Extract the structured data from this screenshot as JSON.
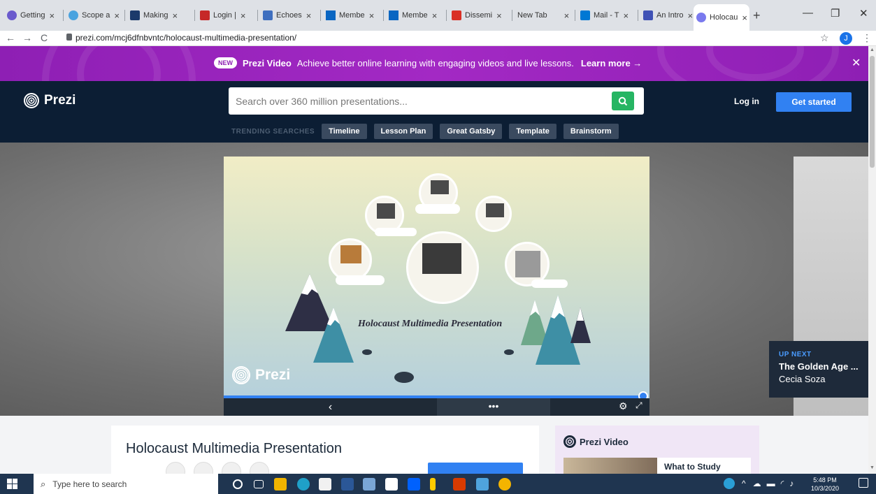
{
  "tabs": [
    {
      "label": "Getting",
      "color": "#6a5acd"
    },
    {
      "label": "Scope a",
      "color": "#4aa3df"
    },
    {
      "label": "Making",
      "color": "#1b3a6b"
    },
    {
      "label": "Login |",
      "color": "#c62828"
    },
    {
      "label": "Echoes",
      "color": "#3f6fbf"
    },
    {
      "label": "Membe",
      "color": "#0a66c2"
    },
    {
      "label": "Membe",
      "color": "#0a66c2"
    },
    {
      "label": "Dissemi",
      "color": "#d93025"
    },
    {
      "label": "New Tab",
      "color": ""
    },
    {
      "label": "Mail - T",
      "color": "#0078d4"
    },
    {
      "label": "An Intro",
      "color": "#3f51b5"
    },
    {
      "label": "Holocau",
      "color": "#7a7aee"
    }
  ],
  "tab_close": "×",
  "new_tab": "+",
  "window": {
    "minimize": "—",
    "maximize": "❐",
    "close": "✕"
  },
  "address": {
    "back": "←",
    "forward": "→",
    "reload": "C",
    "url": "prezi.com/mcj6dfnbvntc/holocaust-multimedia-presentation/",
    "star": "☆",
    "profile": "J",
    "menu": "⋮"
  },
  "promo": {
    "badge": "NEW",
    "brand": "Prezi Video",
    "text": "Achieve better online learning with engaging videos and live lessons.",
    "link": "Learn more →",
    "close": "✕"
  },
  "header": {
    "logo": "Prezi",
    "search_placeholder": "Search over 360 million presentations...",
    "search_icon": "search-icon",
    "trending_label": "TRENDING SEARCHES",
    "trending": [
      "Timeline",
      "Lesson Plan",
      "Great Gatsby",
      "Template",
      "Brainstorm"
    ],
    "login": "Log in",
    "get_started": "Get started"
  },
  "player": {
    "slide_title": "Holocaust Multimedia Presentation",
    "slide_logo": "Prezi",
    "progress": 0.985,
    "prev": "‹",
    "more": "•••",
    "settings": "⚙",
    "fullscreen": "⤢"
  },
  "upnext": {
    "label": "UP NEXT",
    "title": "The Golden Age ...",
    "author": "Cecia Soza"
  },
  "details": {
    "title": "Holocaust Multimedia Presentation"
  },
  "video": {
    "title": "Prezi Video",
    "card": "What to Study"
  },
  "taskbar": {
    "search": "Type here to search",
    "time": "5:48 PM",
    "date": "10/3/2020"
  }
}
